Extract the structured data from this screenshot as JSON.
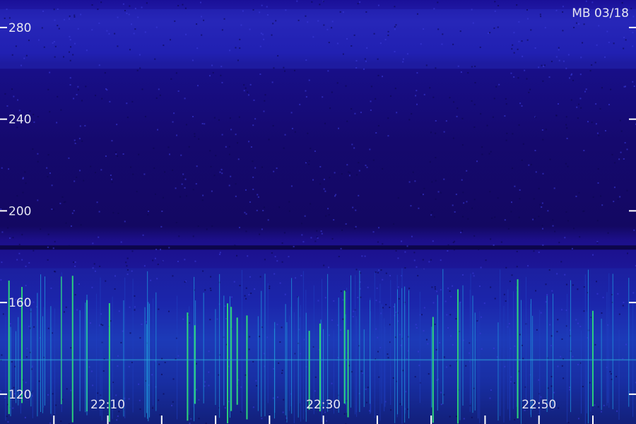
{
  "chart_data": {
    "type": "heatmap",
    "title": "",
    "annotation": "MB 03/18",
    "xlabel": "",
    "ylabel": "",
    "x_ticks": [
      "22:10",
      "22:30",
      "22:50"
    ],
    "y_ticks": [
      120,
      160,
      200,
      240,
      280
    ],
    "ylim": [
      107,
      292
    ],
    "xlim_minutes": [
      "22:00",
      "22:59"
    ],
    "colors": {
      "background": "#1a1190",
      "low": "#140a6e",
      "mid": "#1f3fc0",
      "high": "#2fe07a",
      "text": "#e6e6f2"
    },
    "features": [
      {
        "name": "horizontal band",
        "y_range": [
          262,
          288
        ]
      },
      {
        "name": "dark line",
        "y": 184
      },
      {
        "name": "activity region",
        "y_range": [
          107,
          175
        ]
      }
    ]
  }
}
